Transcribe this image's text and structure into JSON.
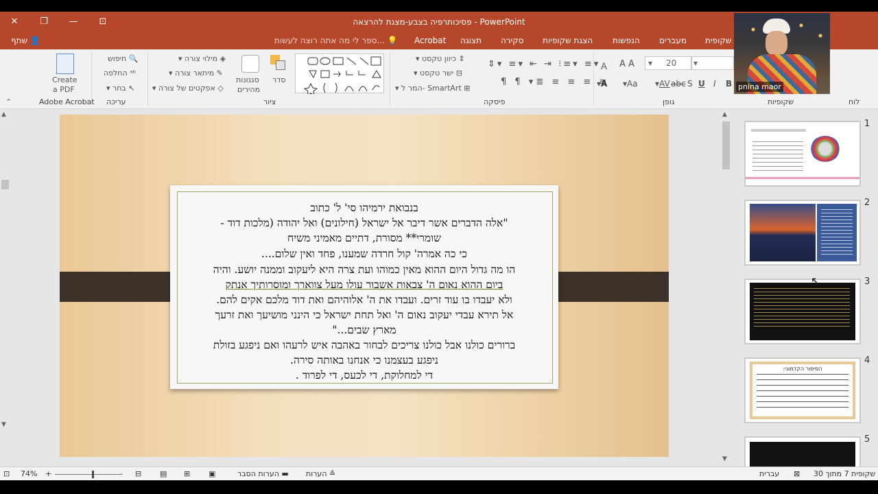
{
  "window": {
    "title": "פסיכותרפיה בצבע-מצגת להרצאה - PowerPoint"
  },
  "tabs": {
    "labels": [
      "שקופית",
      "מעברים",
      "הנפשות",
      "הצגת שקופיות",
      "סקירה",
      "תצוגה",
      "Acrobat"
    ],
    "share": "שתף",
    "tellme": "ספר לי מה אתה רוצה לעשות..."
  },
  "ribbon": {
    "acrobat": {
      "create_pdf_line1": "Create",
      "create_pdf_line2": "a PDF",
      "group": "Adobe Acrobat"
    },
    "editing": {
      "find": "חיפוש",
      "replace": "החלפה",
      "select": "בחר",
      "group": "עריכה"
    },
    "drawing": {
      "fill": "מילוי צורה",
      "outline": "מיתאר צורה",
      "effects": "אפקטים של צורה",
      "styles_line1": "סגנונות",
      "styles_line2": "מהירים",
      "arrange": "סדר",
      "group": "ציור"
    },
    "paragraph": {
      "text_direction": "כיוון טקסט",
      "align_text": "ישר טקסט",
      "smartart": "המר ל- SmartArt",
      "group": "פיסקה"
    },
    "font": {
      "size": "20",
      "group": "גופן",
      "bold": "B",
      "italic": "I",
      "underline": "U",
      "shadow": "S",
      "strike": "abc",
      "spacing": "AV",
      "case": "Aa"
    },
    "clipboard": {
      "group": "לוח"
    },
    "slides": {
      "group": "שקופיות"
    }
  },
  "slide": {
    "lines": [
      "בנבואת ירמיהו סי' ל' כתוב",
      "\"אלה הדברים אשר דיבר אל ישראל (חילונים) ואל יהודה (מלכות דוד -",
      "שומרי** מסורת, דתיים מאמיני משיח",
      "כי כה אמרה' קול חרדה שמענו, פחד ואין שלום....",
      "הו מה גדול היום ההוא  מאין כמוהו ועת צרה היא ליעקוב וממנה יושע.  והיה",
      "ביום ההוא נאום ה' צבאות אשבור עולו מעל צווארך ומוסרותיך אנתק",
      "ולא יעבדו בו עוד זרים. ועבדו את ה' אלוהיהם ואת דוד מלכם אקים להם.",
      "אל תירא עבדי יעקוב נאום ה' ואל תחת ישראל כי הינני מושיעך ואת זרעך",
      "מארץ שבים...\"",
      "ברורים כולנו אבל כולנו צריכים לבחור באהבה איש לרעהו ואם ניפגע בזולת",
      "ניפגע בעצמנו כי אנחנו באותה סירה.",
      "די למחלוקת, די לכעס, די לפרוד ."
    ]
  },
  "thumbs": {
    "numbers": [
      "1",
      "2",
      "3",
      "4",
      "5"
    ],
    "slide4_title": "הסיפור הקדמוני:"
  },
  "webcam": {
    "name": "pnina maor"
  },
  "status": {
    "slide_of": "שקופית 7 מתוך 30",
    "language": "עברית",
    "notes": "הערות",
    "comments": "הערות הסבר",
    "zoom": "74%"
  }
}
